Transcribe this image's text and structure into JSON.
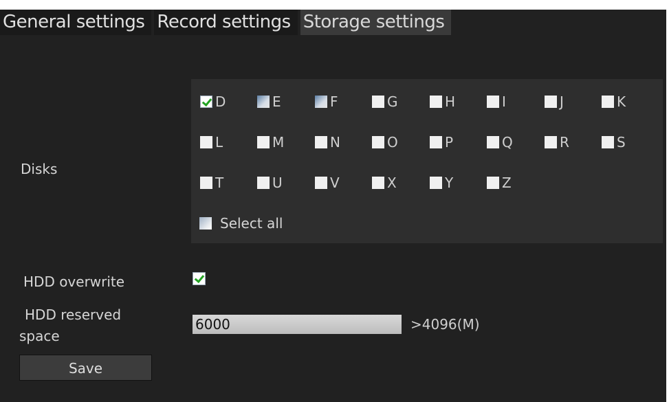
{
  "tabs": [
    {
      "label": "General settings",
      "active": false
    },
    {
      "label": "Record settings",
      "active": false
    },
    {
      "label": "Storage settings",
      "active": true
    }
  ],
  "disks": {
    "label": "Disks",
    "items": [
      {
        "letter": "D",
        "state": "checked"
      },
      {
        "letter": "E",
        "state": "grey"
      },
      {
        "letter": "F",
        "state": "grey"
      },
      {
        "letter": "G",
        "state": "unchecked"
      },
      {
        "letter": "H",
        "state": "unchecked"
      },
      {
        "letter": "I",
        "state": "unchecked"
      },
      {
        "letter": "J",
        "state": "unchecked"
      },
      {
        "letter": "K",
        "state": "unchecked"
      },
      {
        "letter": "L",
        "state": "unchecked"
      },
      {
        "letter": "M",
        "state": "unchecked"
      },
      {
        "letter": "N",
        "state": "unchecked"
      },
      {
        "letter": "O",
        "state": "unchecked"
      },
      {
        "letter": "P",
        "state": "unchecked"
      },
      {
        "letter": "Q",
        "state": "unchecked"
      },
      {
        "letter": "R",
        "state": "unchecked"
      },
      {
        "letter": "S",
        "state": "unchecked"
      },
      {
        "letter": "T",
        "state": "unchecked"
      },
      {
        "letter": "U",
        "state": "unchecked"
      },
      {
        "letter": "V",
        "state": "unchecked"
      },
      {
        "letter": "X",
        "state": "unchecked"
      },
      {
        "letter": "Y",
        "state": "unchecked"
      },
      {
        "letter": "Z",
        "state": "unchecked"
      }
    ],
    "select_all_label": "Select all",
    "select_all_checked": false
  },
  "hdd_overwrite": {
    "label": "HDD overwrite",
    "checked": true
  },
  "hdd_reserved": {
    "label_line1": "HDD reserved",
    "label_line2": "space",
    "value": "6000",
    "note": ">4096(M)"
  },
  "save_label": "Save",
  "colors": {
    "background": "#212121",
    "panel": "#2e2e2e",
    "check_green": "#22a322",
    "active_tab": "#3a3a3a"
  }
}
